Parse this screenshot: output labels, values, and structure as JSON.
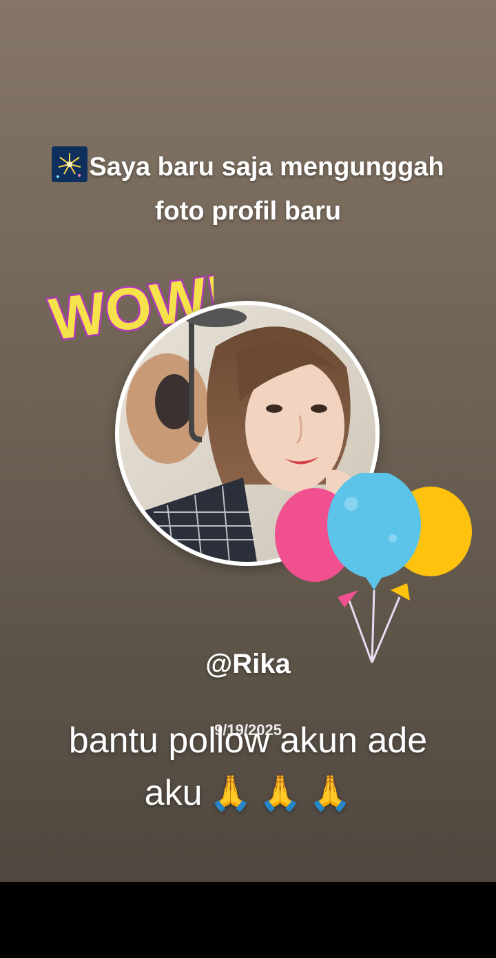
{
  "post": {
    "headline_line1": "Saya baru saja mengunggah",
    "headline_line2": "foto profil baru",
    "headline_icon": "fireworks-icon",
    "sticker_text": "WOW!",
    "username": "@Rika",
    "date": "9/19/2025"
  },
  "caption": {
    "line1": "bantu pollow akun ade",
    "line2": "aku",
    "emoji": "🙏"
  },
  "colors": {
    "background_top": "#857667",
    "background_bottom": "#504840",
    "balloon_pink": "#f0508e",
    "balloon_blue": "#5bc4e8",
    "balloon_yellow": "#ffc20e",
    "wow_yellow": "#f6e24a",
    "wow_outline": "#b03ab8"
  }
}
